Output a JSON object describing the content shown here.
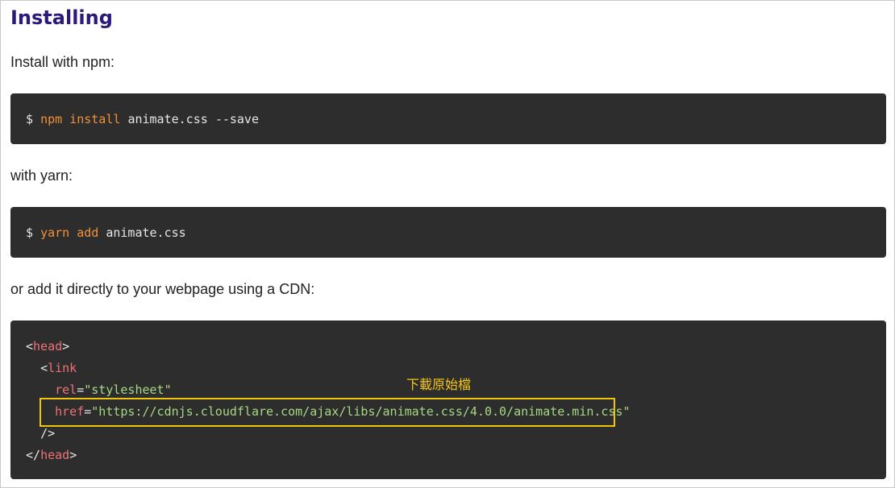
{
  "heading": "Installing",
  "paragraphs": {
    "npm": "Install with npm:",
    "yarn": "with yarn:",
    "cdn": "or add it directly to your webpage using a CDN:"
  },
  "npm_block": {
    "prompt": "$",
    "command": "npm",
    "subcommand": "install",
    "package": "animate.css",
    "flag": "--save"
  },
  "yarn_block": {
    "prompt": "$",
    "command": "yarn",
    "subcommand": "add",
    "package": "animate.css"
  },
  "cdn_block": {
    "open_tag": "head",
    "link_tag": "link",
    "rel_attr": "rel",
    "rel_value": "\"stylesheet\"",
    "href_attr": "href",
    "href_value": "\"https://cdnjs.cloudflare.com/ajax/libs/animate.css/4.0.0/animate.min.css\"",
    "self_close": "/>",
    "close_tag": "head"
  },
  "annotation": {
    "note": "下載原始檔",
    "color": "#f1c40f"
  },
  "colors": {
    "heading": "#2c1a7a",
    "code_bg": "#2d2d2d",
    "keyword": "#f0913a",
    "tag": "#f07178",
    "string": "#a5d982"
  }
}
